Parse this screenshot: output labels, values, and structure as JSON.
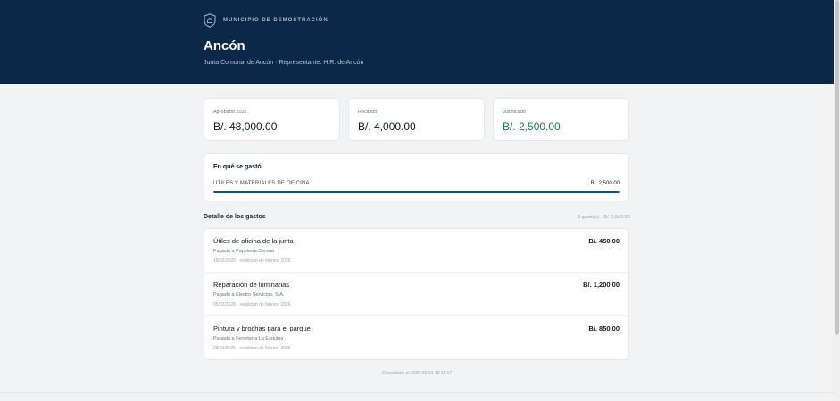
{
  "header": {
    "org_name": "MUNICIPIO DE DEMOSTRACIÓN",
    "title": "Ancón",
    "subtitle": "Junta Comunal de Ancón · Representante: H.R. de Ancón"
  },
  "stats": [
    {
      "label": "Aprobado 2026",
      "value": "B/. 48,000.00"
    },
    {
      "label": "Recibido",
      "value": "B/. 4,000.00"
    },
    {
      "label": "Justificado",
      "value": "B/. 2,500.00",
      "color": "#1f7a55"
    }
  ],
  "spending": {
    "title": "En qué se gastó",
    "categories": [
      {
        "name": "UTILES Y MATERIALES DE OFICINA",
        "amount": "B/. 2,500.00",
        "share": 1.0
      }
    ],
    "bar_color": "#1f4e79"
  },
  "details": {
    "title": "Detalle de los gastos",
    "summary": "3 gasto(s) · B/. 2,500.00",
    "items": [
      {
        "title": "Útiles de oficina de la junta",
        "payee": "Pagado a Papelería Central",
        "date": "19/02/2026 · rendición de febrero 2026",
        "amount": "B/. 450.00"
      },
      {
        "title": "Reparación de luminarias",
        "payee": "Pagado a Electro Servicios, S.A.",
        "date": "05/02/2026 · rendición de febrero 2026",
        "amount": "B/. 1,200.00"
      },
      {
        "title": "Pintura y brochas para el parque",
        "payee": "Pagado a Ferretería La Esquina",
        "date": "28/01/2026 · rendición de febrero 2026",
        "amount": "B/. 850.00"
      }
    ]
  },
  "footer": {
    "consulted": "Consultado el 2026-05-21 12:11:17"
  },
  "colors": {
    "header_bg": "#0c2848",
    "accent_green": "#1f7a55",
    "page_bg": "#f2f3f5"
  },
  "icons": {
    "brand": "shield-icon"
  }
}
